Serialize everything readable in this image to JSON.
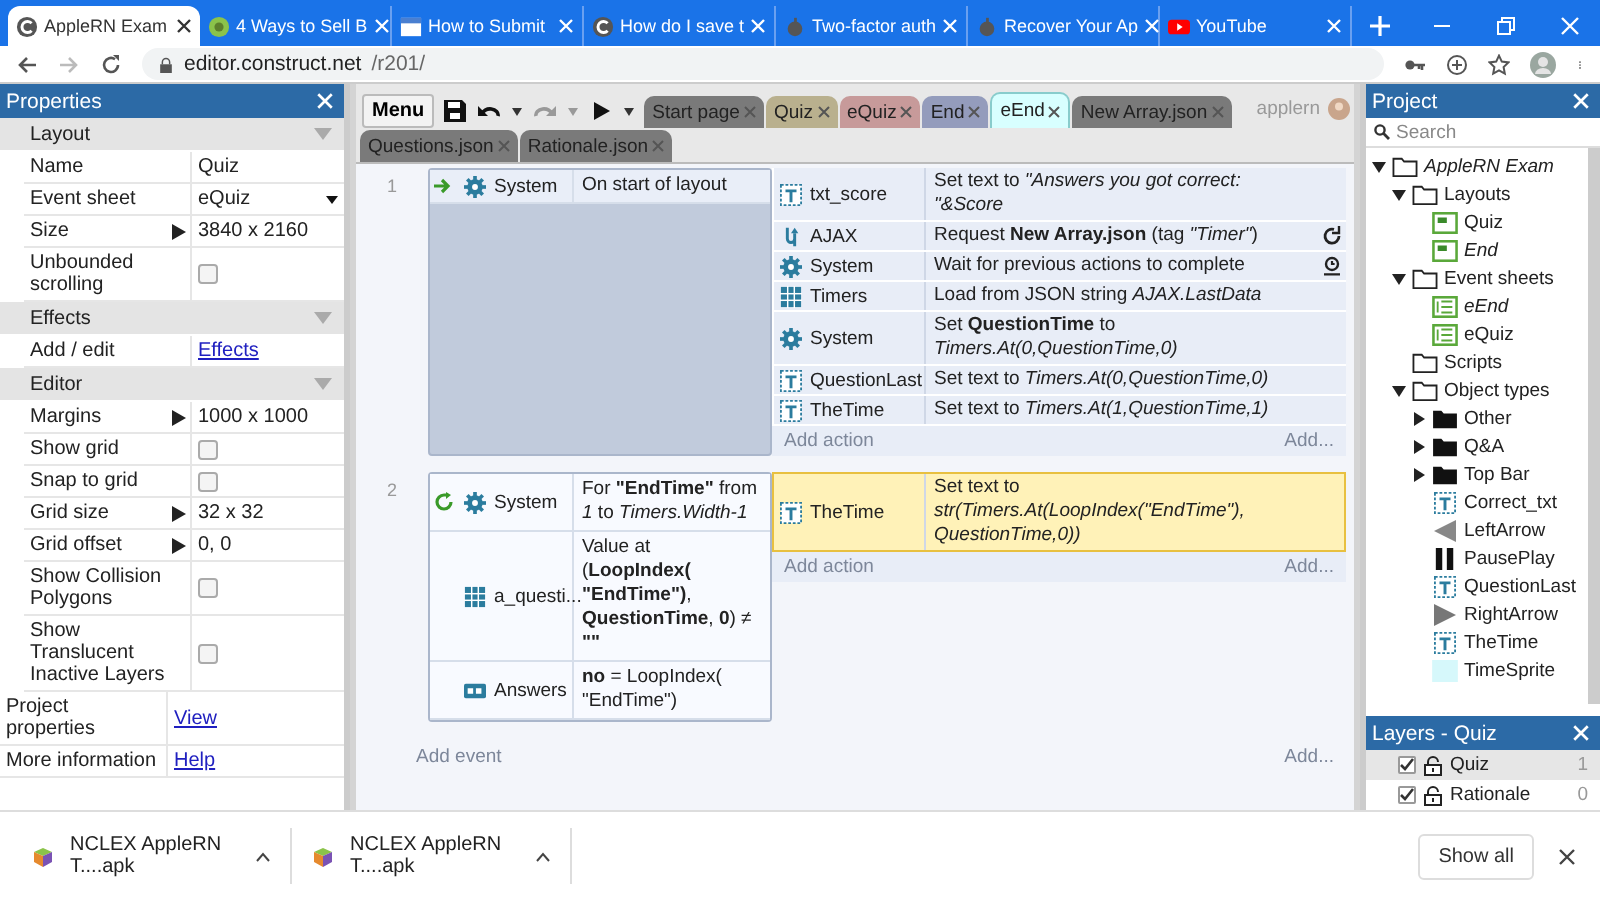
{
  "browser": {
    "tabs": [
      {
        "title": "AppleRN Exam",
        "kind": "construct",
        "selected": true
      },
      {
        "title": "4 Ways to Sell B",
        "kind": "globe",
        "selected": false
      },
      {
        "title": "How to Submit",
        "kind": "page",
        "selected": false
      },
      {
        "title": "How do I save t",
        "kind": "construct",
        "selected": false
      },
      {
        "title": "Two-factor auth",
        "kind": "apple",
        "selected": false
      },
      {
        "title": "Recover Your Ap",
        "kind": "apple",
        "selected": false
      },
      {
        "title": "YouTube",
        "kind": "video",
        "selected": false
      }
    ],
    "url_host": "editor.construct.net",
    "url_path": "/r201/"
  },
  "properties": {
    "title": "Properties",
    "sections": [
      {
        "title": "Layout",
        "rows": [
          {
            "kind": "text",
            "label": "Name",
            "value": "Quiz"
          },
          {
            "kind": "dropdown",
            "label": "Event sheet",
            "value": "eQuiz"
          },
          {
            "kind": "expand",
            "label": "Size",
            "value": "3840 x 2160"
          },
          {
            "kind": "checkbox",
            "label": "Unbounded scrolling",
            "checked": false
          }
        ]
      },
      {
        "title": "Effects",
        "rows": [
          {
            "kind": "link",
            "label": "Add / edit",
            "value": "Effects"
          }
        ]
      },
      {
        "title": "Editor",
        "rows": [
          {
            "kind": "expand",
            "label": "Margins",
            "value": "1000 x 1000"
          },
          {
            "kind": "checkbox",
            "label": "Show grid",
            "checked": false
          },
          {
            "kind": "checkbox",
            "label": "Snap to grid",
            "checked": false
          },
          {
            "kind": "expand",
            "label": "Grid size",
            "value": "32 x 32"
          },
          {
            "kind": "expand",
            "label": "Grid offset",
            "value": "0, 0"
          },
          {
            "kind": "checkbox",
            "label": "Show Collision Polygons",
            "checked": false
          },
          {
            "kind": "checkbox",
            "label": "Show Translucent Inactive Layers",
            "checked": false
          }
        ]
      }
    ],
    "footer": [
      {
        "kind": "link",
        "label": "Project properties",
        "value": "View"
      },
      {
        "kind": "link",
        "label": "More information",
        "value": "Help"
      }
    ]
  },
  "toolbar": {
    "menu": "Menu",
    "user": "applern"
  },
  "sheet_tabs": [
    {
      "label": "Start page",
      "color": "#7a7a7a",
      "selected": false
    },
    {
      "label": "Quiz",
      "color": "#b9b08e",
      "selected": false
    },
    {
      "label": "eQuiz",
      "color": "#c79a9a",
      "selected": false
    },
    {
      "label": "End",
      "color": "#949cbc",
      "selected": false
    },
    {
      "label": "eEnd",
      "color": "#d8ffff",
      "selected": true
    },
    {
      "label": "New Array.json",
      "color": "#7a7a7a",
      "selected": false
    },
    {
      "label": "Questions.json",
      "color": "#7a7a7a",
      "selected": false
    },
    {
      "label": "Rationale.json",
      "color": "#7a7a7a",
      "selected": false
    }
  ],
  "events": [
    {
      "number": "1",
      "kind": "trigger",
      "conditions": [
        {
          "kind": "system",
          "object": "System",
          "text": "On start of layout"
        }
      ],
      "actions": [
        {
          "kind": "text",
          "object": "txt_score",
          "text": "Set text to *\"Answers you got correct: \"&Score*",
          "selected": false
        },
        {
          "kind": "ajax",
          "object": "AJAX",
          "text": "Request **New Array.json** (tag *\"Timer\"*)",
          "selected": false
        },
        {
          "kind": "wait",
          "object": "System",
          "text": "Wait for previous actions to complete",
          "selected": false
        },
        {
          "kind": "array",
          "object": "Timers",
          "text": "Load from JSON string *AJAX.LastData*",
          "selected": false
        },
        {
          "kind": "system",
          "object": "System",
          "text": "Set **QuestionTime** to *Timers.At(0,QuestionTime,0)*",
          "selected": false
        },
        {
          "kind": "text",
          "object": "QuestionLast",
          "text": "Set text to *Timers.At(0,QuestionTime,0)*",
          "selected": false
        },
        {
          "kind": "text",
          "object": "TheTime",
          "text": "Set text to *Timers.At(1,QuestionTime,1)*",
          "selected": false
        }
      ],
      "add_action": "Add action",
      "add_more": "Add..."
    },
    {
      "number": "2",
      "kind": "loop",
      "conditions": [
        {
          "kind": "system",
          "object": "System",
          "text": "For **\"EndTime\"** from *1* to *Timers.Width-1*"
        },
        {
          "kind": "array",
          "object": "a_questi...",
          "text": "Value at (**LoopIndex(** **\"EndTime\")**, **QuestionTime**, **0**) ≠ **\"\"**"
        },
        {
          "kind": "dictionary",
          "object": "Answers",
          "text": "**no** = LoopIndex( \"EndTime\")"
        }
      ],
      "actions": [
        {
          "kind": "text",
          "object": "TheTime",
          "text": "Set text to *str(Timers.At(LoopIndex(\"EndTime\"), QuestionTime,0))*",
          "selected": true
        }
      ],
      "add_action": "Add action",
      "add_more": "Add..."
    }
  ],
  "add_event": "Add event",
  "add_event_more": "Add...",
  "project": {
    "title": "Project",
    "search_placeholder": "Search",
    "tree": [
      {
        "label": "AppleRN Exam",
        "kind": "folder",
        "emphasized": true,
        "expanded": true,
        "children": [
          {
            "label": "Layouts",
            "kind": "folder",
            "emphasized": false,
            "expanded": true,
            "children": [
              {
                "label": "Quiz",
                "kind": "layout",
                "emphasized": false
              },
              {
                "label": "End",
                "kind": "layout",
                "emphasized": true
              }
            ]
          },
          {
            "label": "Event sheets",
            "kind": "folder",
            "emphasized": false,
            "expanded": true,
            "children": [
              {
                "label": "eEnd",
                "kind": "sheet",
                "emphasized": true
              },
              {
                "label": "eQuiz",
                "kind": "sheet",
                "emphasized": false
              }
            ]
          },
          {
            "label": "Scripts",
            "kind": "folder",
            "emphasized": false
          },
          {
            "label": "Object types",
            "kind": "folder",
            "emphasized": false,
            "expanded": true,
            "children": [
              {
                "label": "Other",
                "kind": "family",
                "emphasized": false,
                "expanded": false
              },
              {
                "label": "Q&A",
                "kind": "family",
                "emphasized": false,
                "expanded": false
              },
              {
                "label": "Top Bar",
                "kind": "family",
                "emphasized": false,
                "expanded": false
              },
              {
                "label": "Correct_txt",
                "kind": "text",
                "emphasized": false
              },
              {
                "label": "LeftArrow",
                "kind": "left",
                "emphasized": false
              },
              {
                "label": "PausePlay",
                "kind": "pause",
                "emphasized": false
              },
              {
                "label": "QuestionLast",
                "kind": "text",
                "emphasized": false
              },
              {
                "label": "RightArrow",
                "kind": "right",
                "emphasized": false
              },
              {
                "label": "TheTime",
                "kind": "text",
                "emphasized": false
              },
              {
                "label": "TimeSprite",
                "kind": "sprite",
                "emphasized": false
              }
            ]
          }
        ]
      }
    ]
  },
  "layers": {
    "title": "Layers - Quiz",
    "items": [
      {
        "name": "Quiz",
        "count": "1",
        "visible": true,
        "selected": true
      },
      {
        "name": "Rationale",
        "count": "0",
        "visible": true,
        "selected": false
      }
    ]
  },
  "downloads": {
    "items": [
      {
        "name": "NCLEX AppleRN T....apk"
      },
      {
        "name": "NCLEX AppleRN T....apk"
      }
    ],
    "show_all": "Show all"
  }
}
